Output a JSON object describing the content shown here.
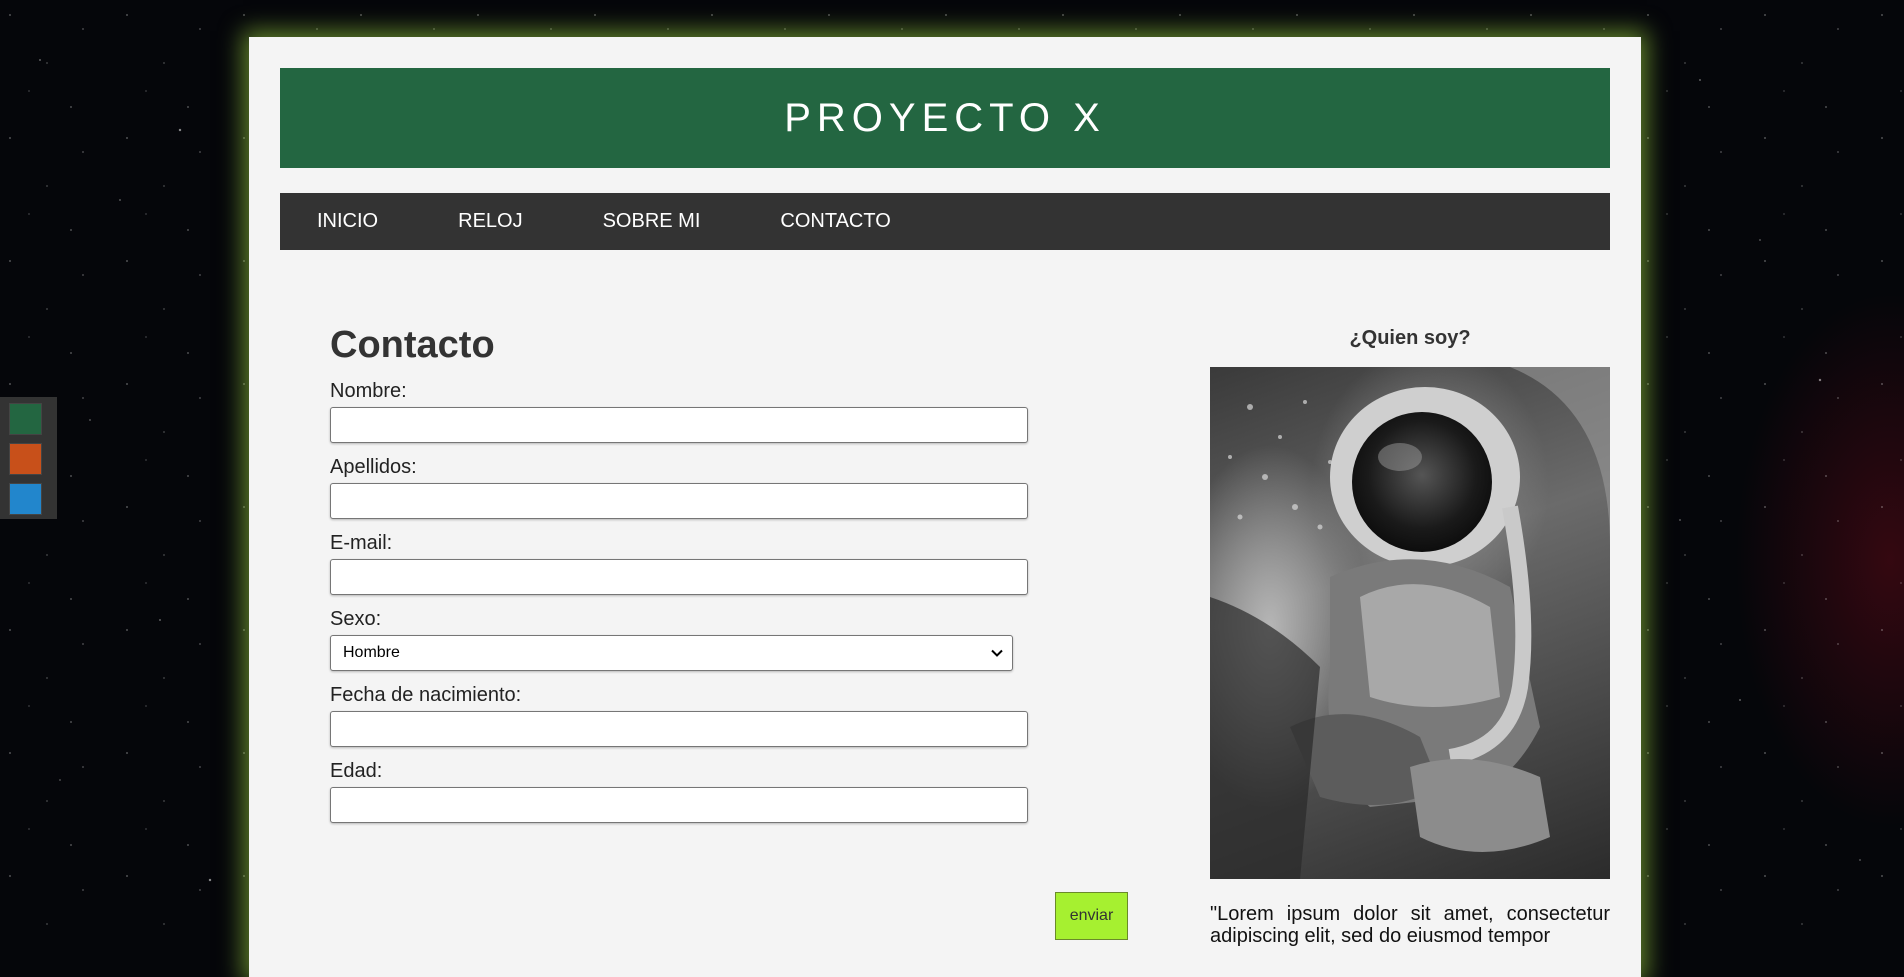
{
  "header": {
    "title": "PROYECTO X"
  },
  "nav": {
    "items": [
      {
        "label": "INICIO"
      },
      {
        "label": "RELOJ"
      },
      {
        "label": "SOBRE MI"
      },
      {
        "label": "CONTACTO"
      }
    ]
  },
  "form": {
    "heading": "Contacto",
    "nombre_label": "Nombre:",
    "apellidos_label": "Apellidos:",
    "email_label": "E-mail:",
    "sexo_label": "Sexo:",
    "sexo_selected": "Hombre",
    "fecha_label": "Fecha de nacimiento:",
    "edad_label": "Edad:",
    "submit_label": "enviar"
  },
  "aside": {
    "heading": "¿Quien soy?",
    "text": "\"Lorem ipsum dolor sit amet, consectetur adipiscing elit, sed do eiusmod tempor"
  },
  "theme_swatches": {
    "colors": [
      "#236641",
      "#c8501a",
      "#2286cc"
    ]
  }
}
